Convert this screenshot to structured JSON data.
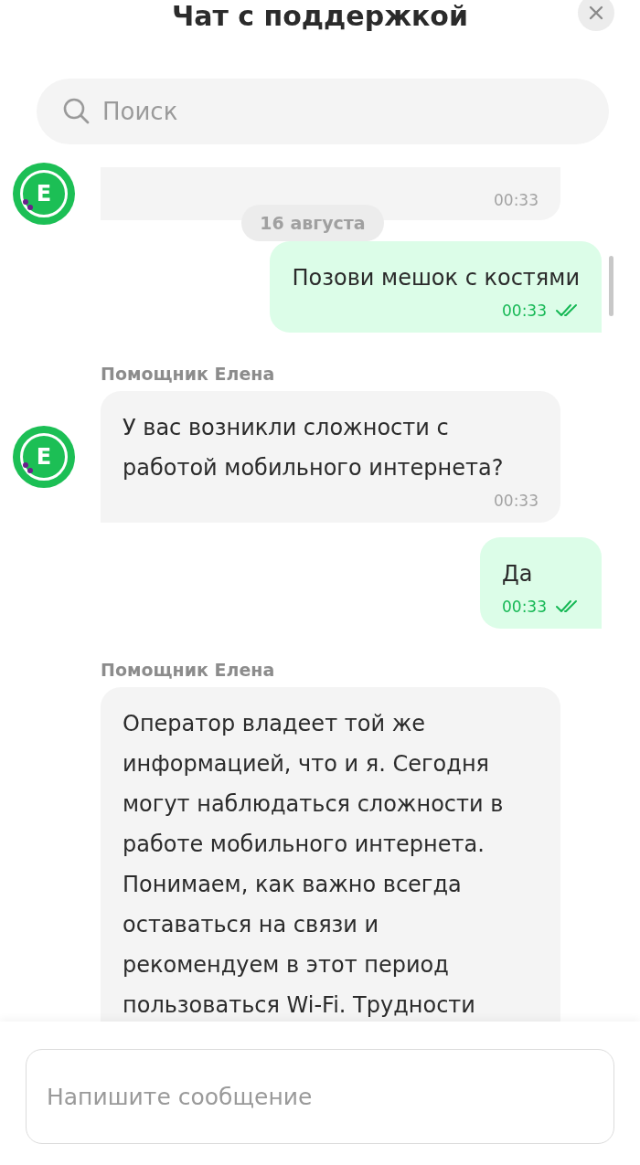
{
  "header": {
    "title": "Чат с поддержкой"
  },
  "search": {
    "placeholder": "Поиск"
  },
  "messages": [
    {
      "kind": "incoming",
      "avatar": "E",
      "time": "00:33"
    },
    {
      "kind": "date",
      "text": "16 августа"
    },
    {
      "kind": "outgoing",
      "text": "Позови мешок с костями",
      "time": "00:33",
      "read": true
    },
    {
      "kind": "incoming",
      "avatar": "E",
      "sender": "Помощник Елена",
      "text": "У вас возникли сложности с работой мобильного интернета?",
      "time": "00:33"
    },
    {
      "kind": "outgoing",
      "text": "Да",
      "time": "00:33",
      "read": true
    },
    {
      "kind": "incoming",
      "sender": "Помощник Елена",
      "text": "Оператор владеет той же информацией, что и я. Сегодня могут наблюдаться сложности в работе мобильного интернета. Понимаем, как важно всегда оставаться на связи и рекомендуем в этот период пользоваться Wi-Fi. Трудности"
    }
  ],
  "composer": {
    "placeholder": "Напишите сообщение"
  }
}
